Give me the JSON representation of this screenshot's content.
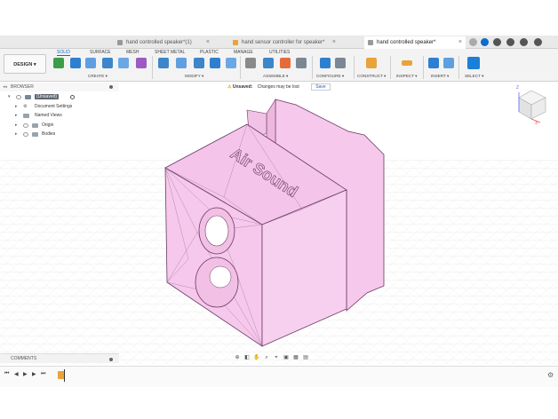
{
  "tabs": [
    {
      "label": "hand controlled speaker*(1)",
      "active": false
    },
    {
      "label": "hand sensor controller for speaker*",
      "active": false
    },
    {
      "label": "hand controlled speaker*",
      "active": true
    }
  ],
  "ribbon": {
    "design_label": "DESIGN ▾",
    "tabs": [
      "SOLID",
      "SURFACE",
      "MESH",
      "SHEET METAL",
      "PLASTIC",
      "MANAGE",
      "UTILITIES"
    ],
    "active_tab": "SOLID",
    "groups": [
      "CREATE ▾",
      "MODIFY ▾",
      "ASSEMBLE ▾",
      "CONFIGURE ▾",
      "CONSTRUCT ▾",
      "INSPECT ▾",
      "INSERT ▾",
      "SELECT ▾"
    ]
  },
  "notice": {
    "status": "Unsaved:",
    "message": "Changes may be lost",
    "save_label": "Save"
  },
  "browser": {
    "title": "BROWSER",
    "items": [
      {
        "label": "(Unsaved)"
      },
      {
        "label": "Document Settings"
      },
      {
        "label": "Named Views"
      },
      {
        "label": "Origin"
      },
      {
        "label": "Bodies"
      }
    ]
  },
  "comments": {
    "title": "COMMENTS"
  },
  "model": {
    "embossed_text": "Air Sound",
    "body_color": "#f6c8ec",
    "edge_color": "#6b3a62"
  },
  "viewcube": {
    "z_label": "Z",
    "x_label": "X"
  },
  "colors": {
    "accent": "#0b6bcb",
    "warning": "#e6a100"
  }
}
